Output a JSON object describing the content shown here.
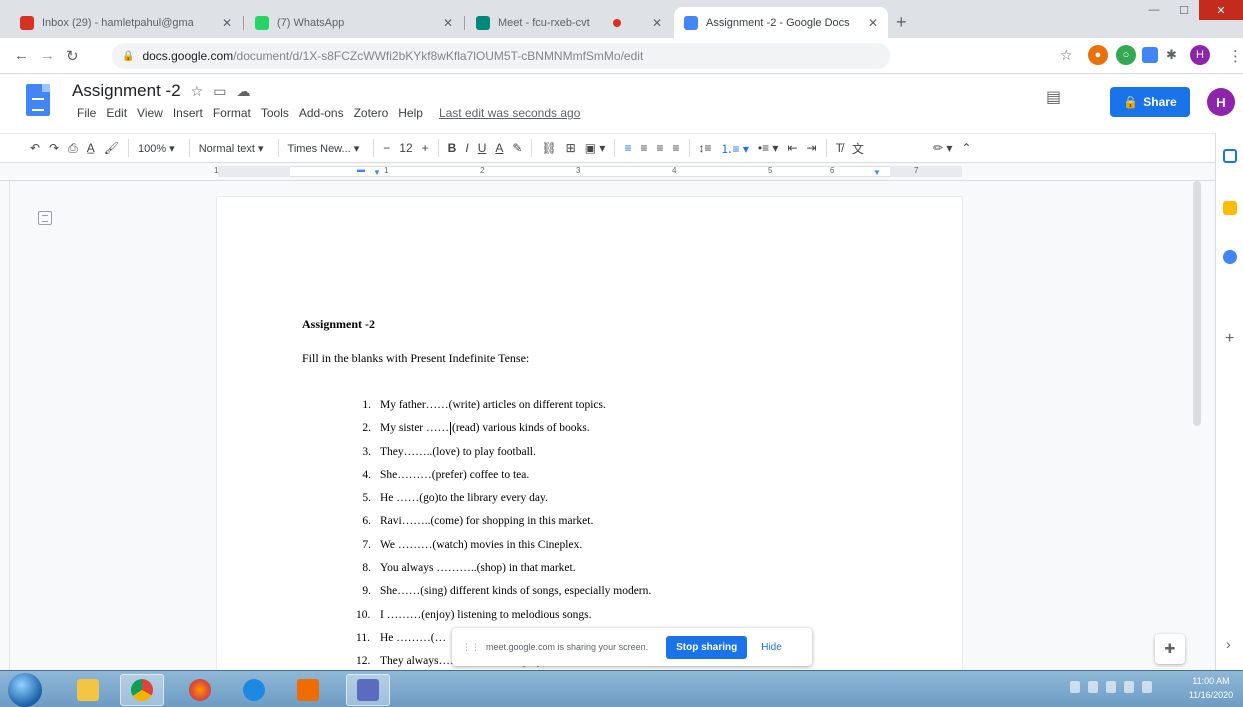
{
  "browser": {
    "tabs": [
      {
        "title": "Inbox (29) - hamletpahul@gma",
        "favicon_color": "#d93025",
        "active": false
      },
      {
        "title": "(7) WhatsApp",
        "favicon_color": "#25d366",
        "active": false
      },
      {
        "title": "Meet - fcu-rxeb-cvt",
        "favicon_color": "#00897b",
        "active": false,
        "recording": true
      },
      {
        "title": "Assignment -2 - Google Docs",
        "favicon_color": "#4285f4",
        "active": true
      }
    ],
    "url_host": "docs.google.com",
    "url_path": "/document/d/1X-s8FCZcWWfi2bKYkf8wKfla7lOUM5T-cBNMNMmfSmMo/edit"
  },
  "doc": {
    "title": "Assignment -2",
    "menu": [
      "File",
      "Edit",
      "View",
      "Insert",
      "Format",
      "Tools",
      "Add-ons",
      "Zotero",
      "Help"
    ],
    "last_edit": "Last edit was seconds ago",
    "share_label": "Share",
    "avatar_initial": "H"
  },
  "format_toolbar": {
    "zoom": "100%",
    "style": "Normal text",
    "font": "Times New...",
    "size": "12"
  },
  "ruler_numbers": [
    "1",
    "1",
    "2",
    "3",
    "4",
    "5",
    "6",
    "7"
  ],
  "content": {
    "heading": "Assignment -2",
    "instruction": "Fill in the blanks with Present Indefinite Tense:",
    "items": [
      {
        "num": "1.",
        "text": "My father……(write) articles on different topics."
      },
      {
        "num": "2.",
        "text_before": "My sister ……",
        "text_after": "(read) various kinds of books."
      },
      {
        "num": "3.",
        "text": "They……..(love) to play football."
      },
      {
        "num": "4.",
        "text": "She………(prefer) coffee to tea."
      },
      {
        "num": "5.",
        "text": "He ……(go)to the library every day."
      },
      {
        "num": "6.",
        "text": "Ravi……..(come) for shopping in this market."
      },
      {
        "num": "7.",
        "text": "We ………(watch) movies in this Cineplex."
      },
      {
        "num": "8.",
        "text": "You always ………..(shop) in that market."
      },
      {
        "num": "9.",
        "text": "She……(sing) different kinds of songs, especially modern."
      },
      {
        "num": "10.",
        "text": "I ………(enjoy) listening to melodious songs."
      },
      {
        "num": "11.",
        "text": "He ………(…"
      },
      {
        "num": "12.",
        "text": "They always…………………(play) cricket in that field."
      }
    ]
  },
  "screen_share": {
    "message": "meet.google.com is sharing your screen.",
    "stop_label": "Stop sharing",
    "hide_label": "Hide"
  },
  "taskbar": {
    "time": "11:00 AM",
    "date": "11/16/2020"
  }
}
